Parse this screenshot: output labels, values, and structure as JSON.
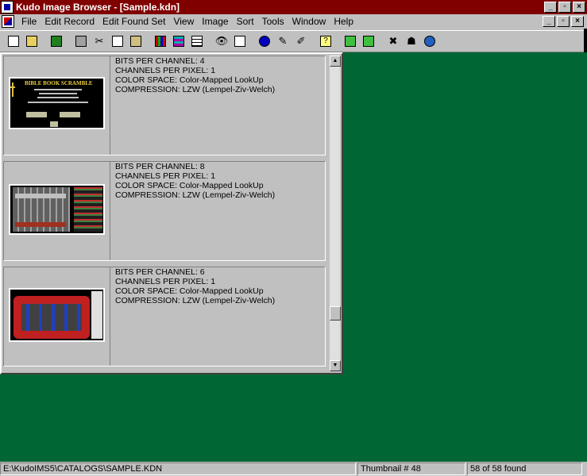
{
  "window": {
    "title": "Kudo Image Browser - [Sample.kdn]"
  },
  "menu": [
    "File",
    "Edit Record",
    "Edit Found Set",
    "View",
    "Image",
    "Sort",
    "Tools",
    "Window",
    "Help"
  ],
  "records": [
    {
      "bits": "BITS PER CHANNEL: 4",
      "channels": "CHANNELS PER PIXEL: 1",
      "colorspace": "COLOR SPACE: Color-Mapped LookUp",
      "compression": "COMPRESSION: LZW (Lempel-Ziv-Welch)",
      "thumb_title": "BIBLE BOOK SCRAMBLE"
    },
    {
      "bits": "BITS PER CHANNEL: 8",
      "channels": "CHANNELS PER PIXEL: 1",
      "colorspace": "COLOR SPACE: Color-Mapped LookUp",
      "compression": "COMPRESSION: LZW (Lempel-Ziv-Welch)"
    },
    {
      "bits": "BITS PER CHANNEL: 6",
      "channels": "CHANNELS PER PIXEL: 1",
      "colorspace": "COLOR SPACE: Color-Mapped LookUp",
      "compression": "COMPRESSION: LZW (Lempel-Ziv-Welch)"
    }
  ],
  "status": {
    "path": "E:\\KudoIMS5\\CATALOGS\\SAMPLE.KDN",
    "thumbnail": "Thumbnail # 48",
    "found": "58 of 58 found"
  },
  "colors": {
    "titlebar": "#800000",
    "workspace": "#006633"
  }
}
